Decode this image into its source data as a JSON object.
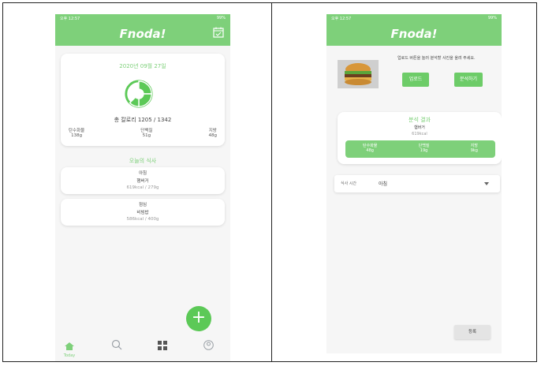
{
  "left": {
    "status_time": "오후 12:57",
    "status_right": "99%",
    "app_title": "Fnoda!",
    "date": "2020년 09월 27일",
    "calorie_text": "총 칼로리 1205 / 1342",
    "macros": [
      {
        "label": "탄수화물",
        "value": "138g"
      },
      {
        "label": "단백질",
        "value": "51g"
      },
      {
        "label": "지방",
        "value": "48g"
      }
    ],
    "meals_heading": "오늘의 식사",
    "meals": [
      {
        "time": "아침",
        "name": "햄버거",
        "info": "619kcal / 279g"
      },
      {
        "time": "점심",
        "name": "비빔밥",
        "info": "586kcal / 400g"
      }
    ],
    "fab_label": "+",
    "nav_today": "Today"
  },
  "right": {
    "status_time": "오후 12:57",
    "status_right": "99%",
    "app_title": "Fnoda!",
    "instruction": "업로드 버튼을 눌러 분석할 사진을 올려 주세요.",
    "upload_label": "업로드",
    "analyze_label": "분석하기",
    "result_title": "분석 결과",
    "result_food": "햄버거",
    "result_kcal": "619kcal",
    "result_macros": [
      {
        "label": "탄수화물",
        "value": "48g"
      },
      {
        "label": "단백질",
        "value": "19g"
      },
      {
        "label": "지방",
        "value": "9kg"
      }
    ],
    "meal_time_label": "식사 시간",
    "meal_time_value": "아침",
    "register_label": "등록"
  },
  "colors": {
    "accent": "#7ed07a",
    "button": "#6dcc68",
    "fab": "#5cc957"
  }
}
